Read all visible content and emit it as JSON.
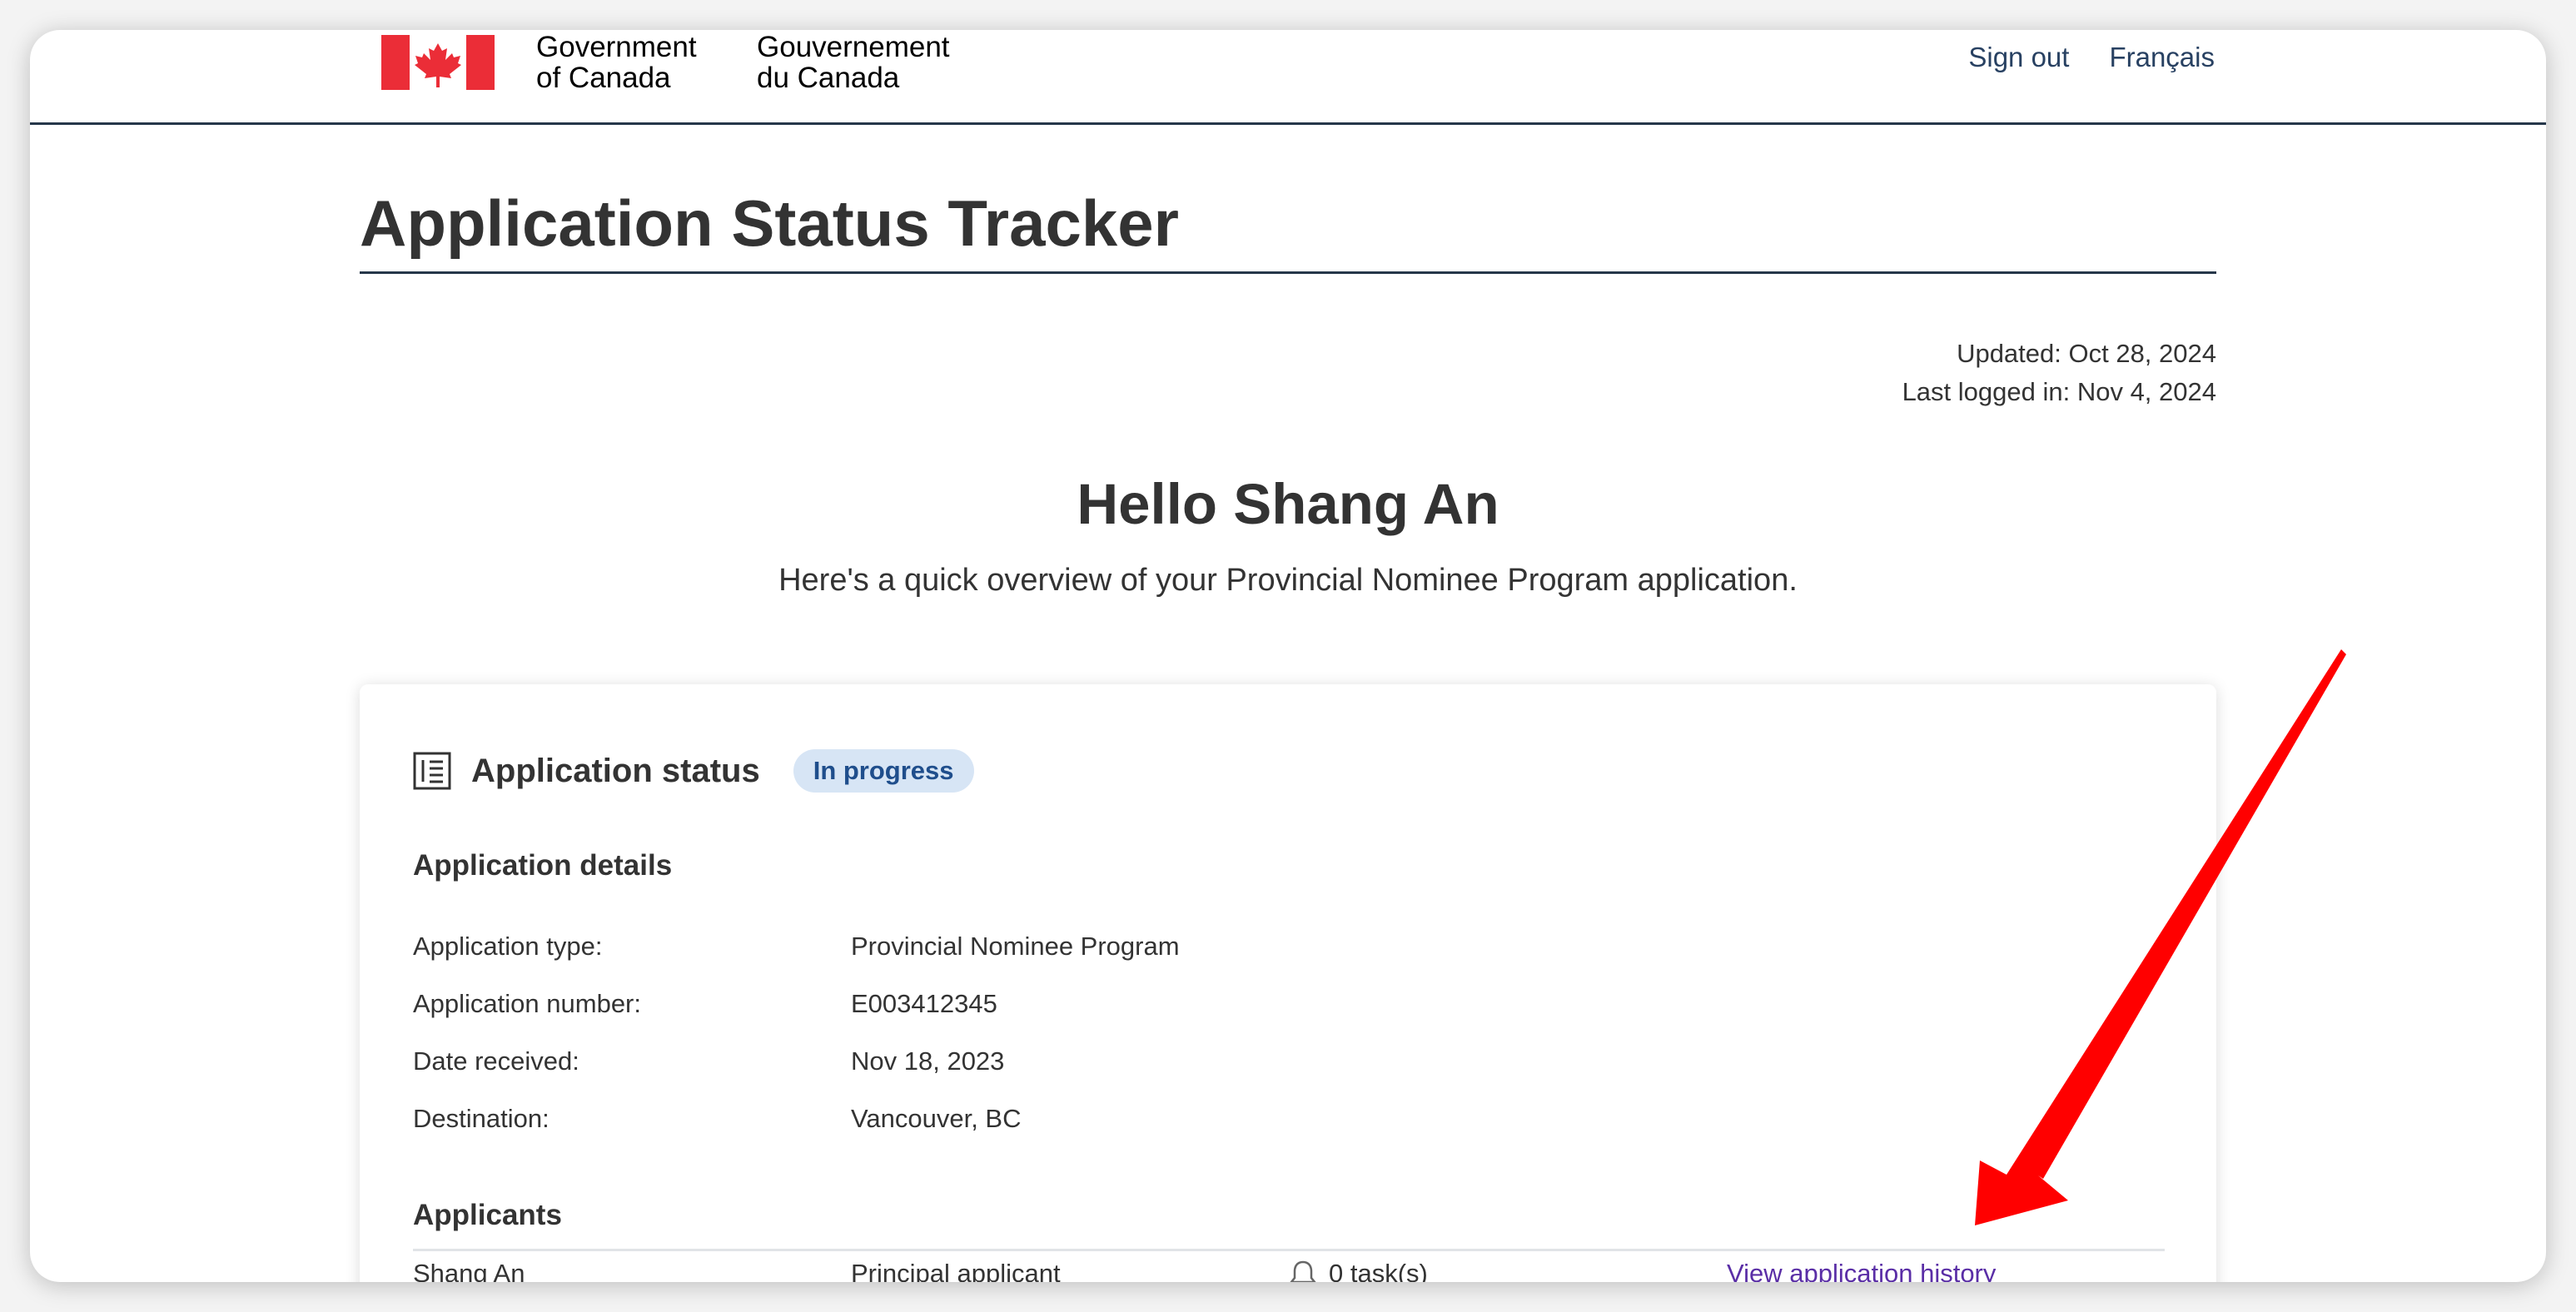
{
  "header": {
    "sig_en_line1": "Government",
    "sig_en_line2": "of Canada",
    "sig_fr_line1": "Gouvernement",
    "sig_fr_line2": "du Canada",
    "nav": {
      "sign_out": "Sign out",
      "language": "Français"
    },
    "flag_icon": "canada-flag-icon"
  },
  "page": {
    "title": "Application Status Tracker",
    "updated": "Updated: Oct 28, 2024",
    "last_logged": "Last logged in: Nov 4, 2024",
    "greeting": "Hello Shang An",
    "overview": "Here's a quick overview of your Provincial Nominee Program application."
  },
  "card": {
    "title": "Application status",
    "status_badge": "In progress",
    "status_icon": "list-document-icon",
    "details_heading": "Application details",
    "details": [
      {
        "label": "Application type:",
        "value": "Provincial Nominee Program"
      },
      {
        "label": "Application number:",
        "value": "E003412345"
      },
      {
        "label": "Date received:",
        "value": "Nov 18, 2023"
      },
      {
        "label": "Destination:",
        "value": "Vancouver, BC"
      }
    ],
    "applicants_heading": "Applicants",
    "applicants": [
      {
        "name": "Shang An",
        "role": "Principal applicant",
        "tasks": "0 task(s)",
        "link": "View application history"
      }
    ]
  },
  "colors": {
    "header_rule": "#26374a",
    "link": "#284162",
    "visited_link": "#5a2ea6",
    "badge_bg": "#d7e5f5",
    "badge_text": "#1f4e8c",
    "flag_red": "#eb2d37",
    "annotation_arrow": "#ff0000"
  }
}
